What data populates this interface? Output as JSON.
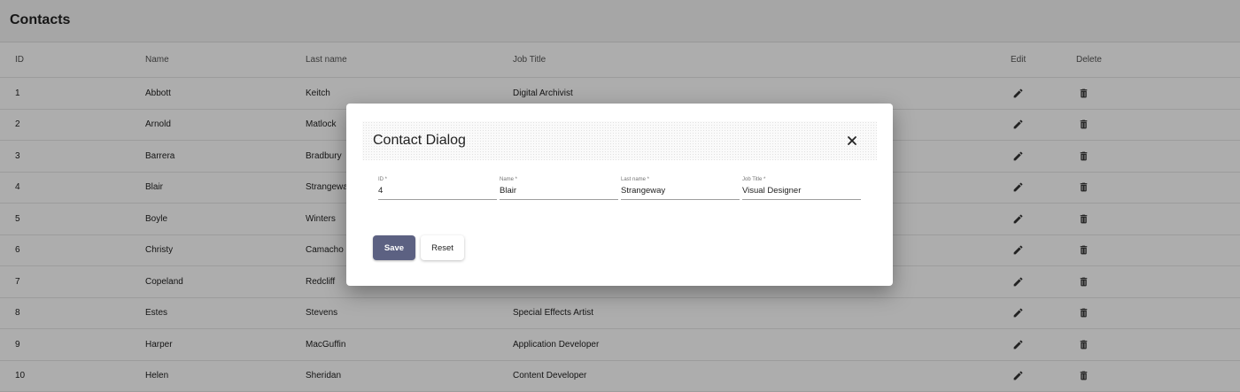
{
  "header": {
    "title": "Contacts"
  },
  "table": {
    "columns": [
      "ID",
      "Name",
      "Last name",
      "Job Title",
      "Edit",
      "Delete"
    ],
    "rows": [
      {
        "id": "1",
        "name": "Abbott",
        "last": "Keitch",
        "job": "Digital Archivist"
      },
      {
        "id": "2",
        "name": "Arnold",
        "last": "Matlock",
        "job": ""
      },
      {
        "id": "3",
        "name": "Barrera",
        "last": "Bradbury",
        "job": ""
      },
      {
        "id": "4",
        "name": "Blair",
        "last": "Strangeway",
        "job": ""
      },
      {
        "id": "5",
        "name": "Boyle",
        "last": "Winters",
        "job": ""
      },
      {
        "id": "6",
        "name": "Christy",
        "last": "Camacho",
        "job": ""
      },
      {
        "id": "7",
        "name": "Copeland",
        "last": "Redcliff",
        "job": ""
      },
      {
        "id": "8",
        "name": "Estes",
        "last": "Stevens",
        "job": "Special Effects Artist"
      },
      {
        "id": "9",
        "name": "Harper",
        "last": "MacGuffin",
        "job": "Application Developer"
      },
      {
        "id": "10",
        "name": "Helen",
        "last": "Sheridan",
        "job": "Content Developer"
      }
    ],
    "edit_icon": "pencil-icon",
    "delete_icon": "trash-icon"
  },
  "dialog": {
    "title": "Contact Dialog",
    "close_icon": "close-icon",
    "fields": {
      "id": {
        "label": "ID *",
        "value": "4"
      },
      "name": {
        "label": "Name *",
        "value": "Blair"
      },
      "last": {
        "label": "Last name *",
        "value": "Strangeway"
      },
      "job": {
        "label": "Job Title *",
        "value": "Visual Designer"
      }
    },
    "save_label": "Save",
    "reset_label": "Reset"
  },
  "colors": {
    "primary": "#5c6182",
    "overlay": "rgba(0,0,0,0.32)"
  }
}
